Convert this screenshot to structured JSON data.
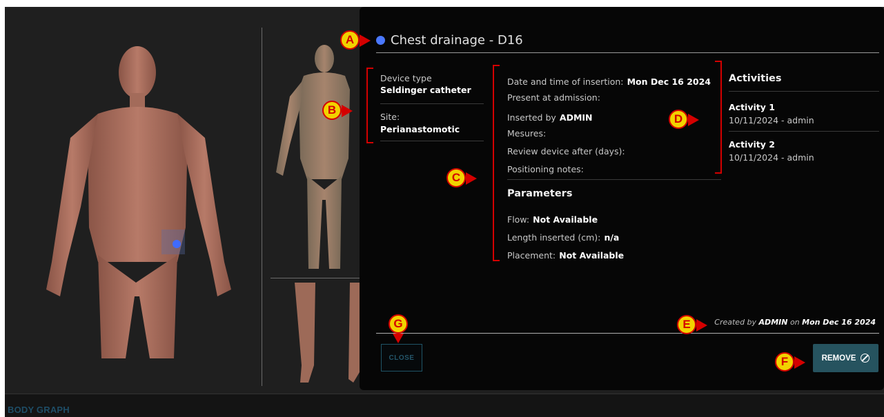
{
  "device": {
    "title": "Chest drainage - D16",
    "dot_color": "#4a78ff"
  },
  "device_info": {
    "type_label": "Device type",
    "type_value": "Seldinger catheter",
    "site_label": "Site:",
    "site_value": "Perianastomotic"
  },
  "details": {
    "insertion_label": "Date and time of insertion:",
    "insertion_value": "Mon Dec 16 2024",
    "present_label": "Present at admission:",
    "inserted_by_label": "Inserted by",
    "inserted_by_value": "ADMIN",
    "mesures_label": "Mesures:",
    "review_label": "Review device after (days):",
    "notes_label": "Positioning notes:"
  },
  "parameters": {
    "heading": "Parameters",
    "flow_label": "Flow:",
    "flow_value": "Not Available",
    "length_label": "Length inserted (cm):",
    "length_value": "n/a",
    "placement_label": "Placement:",
    "placement_value": "Not Available"
  },
  "activities": {
    "heading": "Activities",
    "items": [
      {
        "name": "Activity 1",
        "meta": "10/11/2024 - admin"
      },
      {
        "name": "Activity 2",
        "meta": "10/11/2024 - admin"
      }
    ]
  },
  "footer": {
    "created_prefix": "Created by",
    "created_by": "ADMIN",
    "created_on_word": "on",
    "created_date": "Mon Dec 16 2024",
    "close_label": "CLOSE",
    "remove_label": "REMOVE",
    "remove_icon": "ban-icon"
  },
  "bottom_bar": {
    "label": "BODY GRAPH"
  },
  "callouts": [
    "A",
    "B",
    "C",
    "D",
    "E",
    "F",
    "G"
  ],
  "colors": {
    "panel_bg": "#060606",
    "remove_button": "#26535f",
    "close_button_text": "#24566a",
    "callout_fill": "#f2d200",
    "callout_border": "#d40000",
    "site_dot": "#3f6bff"
  }
}
